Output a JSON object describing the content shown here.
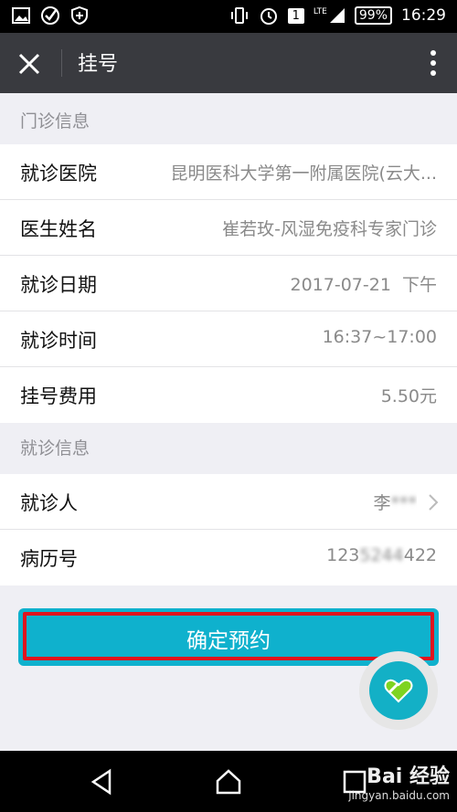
{
  "status_bar": {
    "battery": "99%",
    "time": "16:29",
    "network": "LTE",
    "sim": "1"
  },
  "title_bar": {
    "title": "挂号"
  },
  "clinic_section": {
    "header": "门诊信息",
    "rows": [
      {
        "label": "就诊医院",
        "value": "昆明医科大学第一附属医院(云大..."
      },
      {
        "label": "医生姓名",
        "value": "崔若玫-风湿免疫科专家门诊"
      },
      {
        "label": "就诊日期",
        "value": "2017-07-21  下午"
      },
      {
        "label": "就诊时间",
        "value": "16:37~17:00"
      },
      {
        "label": "挂号费用",
        "value": "5.50元"
      }
    ]
  },
  "patient_section": {
    "header": "就诊信息",
    "rows": [
      {
        "label": "就诊人",
        "value_prefix": "李",
        "value_blurred": "***"
      },
      {
        "label": "病历号",
        "value_prefix": "123",
        "value_blurred": "5244",
        "value_suffix": "422"
      }
    ]
  },
  "confirm_button": {
    "label": "确定预约",
    "color": "#0fb1cd",
    "highlight_color": "#e0141e"
  },
  "watermark": {
    "brand": "Bai 经验",
    "url": "jingyan.baidu.com"
  }
}
